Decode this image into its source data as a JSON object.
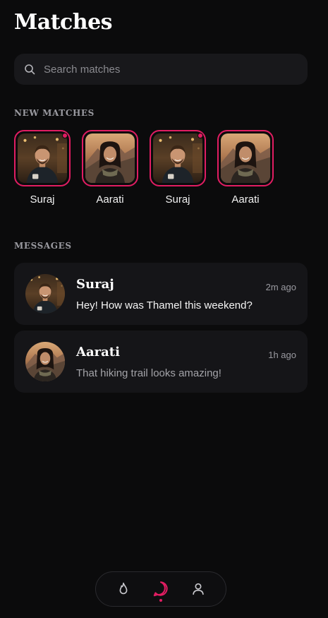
{
  "header": {
    "title": "Matches"
  },
  "search": {
    "placeholder": "Search matches",
    "value": "",
    "icon": "search-icon"
  },
  "new_matches": {
    "label": "NEW MATCHES",
    "items": [
      {
        "name": "Suraj",
        "has_new": true
      },
      {
        "name": "Aarati",
        "has_new": false
      },
      {
        "name": "Suraj",
        "has_new": true
      },
      {
        "name": "Aarati",
        "has_new": false
      }
    ]
  },
  "messages": {
    "label": "MESSAGES",
    "items": [
      {
        "name": "Suraj",
        "time": "2m ago",
        "preview": "Hey! How was Thamel this weekend?",
        "unread": true
      },
      {
        "name": "Aarati",
        "time": "1h ago",
        "preview": "That hiking trail looks amazing!",
        "unread": false
      }
    ]
  },
  "bottom_nav": {
    "tabs": [
      {
        "icon": "flame-icon",
        "active": false
      },
      {
        "icon": "chat-bubble-icon",
        "active": true
      },
      {
        "icon": "user-icon",
        "active": false
      }
    ]
  },
  "colors": {
    "accent": "#e11d62",
    "background": "#0b0b0c",
    "card": "#151518"
  }
}
